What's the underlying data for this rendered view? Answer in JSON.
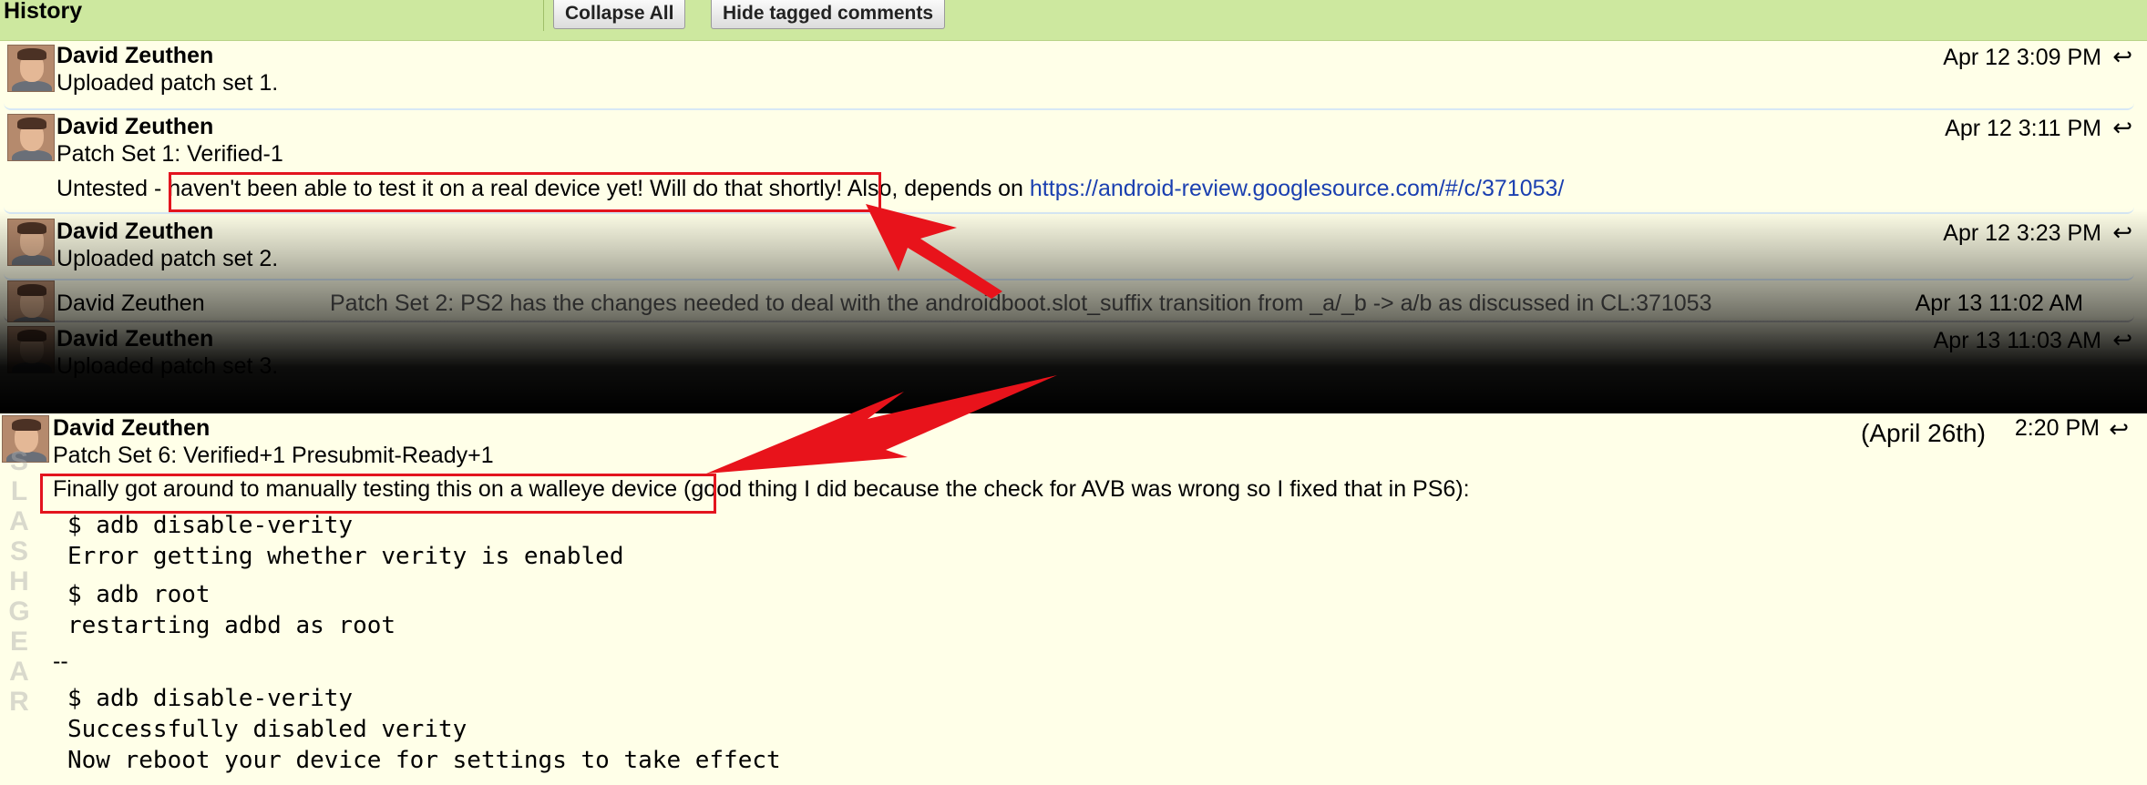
{
  "header": {
    "title": "History",
    "collapse_all": "Collapse All",
    "hide_tagged": "Hide tagged comments"
  },
  "reply_glyph": "↩",
  "messages": [
    {
      "author": "David Zeuthen",
      "date": "Apr 12 3:09 PM",
      "line1": "Uploaded patch set 1."
    },
    {
      "author": "David Zeuthen",
      "date": "Apr 12 3:11 PM",
      "line1": "Patch Set 1: Verified-1",
      "body_prefix": "Untested - ",
      "body_highlight": "haven't been able to test it on a real device yet! Will do that shortly!",
      "body_suffix": " Also, depends on ",
      "body_link": "https://android-review.googlesource.com/#/c/371053/"
    },
    {
      "author": "David Zeuthen",
      "date": "Apr 12 3:23 PM",
      "line1": "Uploaded patch set 2."
    },
    {
      "author": "David Zeuthen",
      "date": "Apr 13 11:02 AM",
      "summary": "Patch Set 2: PS2 has the changes needed to deal with the androidboot.slot_suffix transition from _a/_b -> a/b as discussed in CL:371053"
    },
    {
      "author": "David Zeuthen",
      "date": "Apr 13 11:03 AM",
      "line1": "Uploaded patch set 3."
    },
    {
      "author": "David Zeuthen",
      "date_note": "(April 26th)",
      "date": "2:20 PM",
      "line1": "Patch Set 6: Verified+1 Presubmit-Ready+1",
      "body_highlight": "Finally got around to manually testing this on a walleye device",
      "body_suffix": " (good thing I did because the check for AVB was wrong so I fixed that in PS6):",
      "code1": [
        "$ adb disable-verity",
        "Error getting whether verity is enabled"
      ],
      "code2": [
        "$ adb root",
        "restarting adbd as root"
      ],
      "separator": "--",
      "code3": [
        "$ adb disable-verity",
        "Successfully disabled verity",
        "Now reboot your device for settings to take effect"
      ]
    }
  ],
  "watermark": "SLASHGEAR",
  "colors": {
    "header_bg": "#cde89f",
    "page_bg": "#ffffe8",
    "highlight_box": "#e3141e",
    "arrow": "#e8131b",
    "link": "#1a3fb0"
  }
}
